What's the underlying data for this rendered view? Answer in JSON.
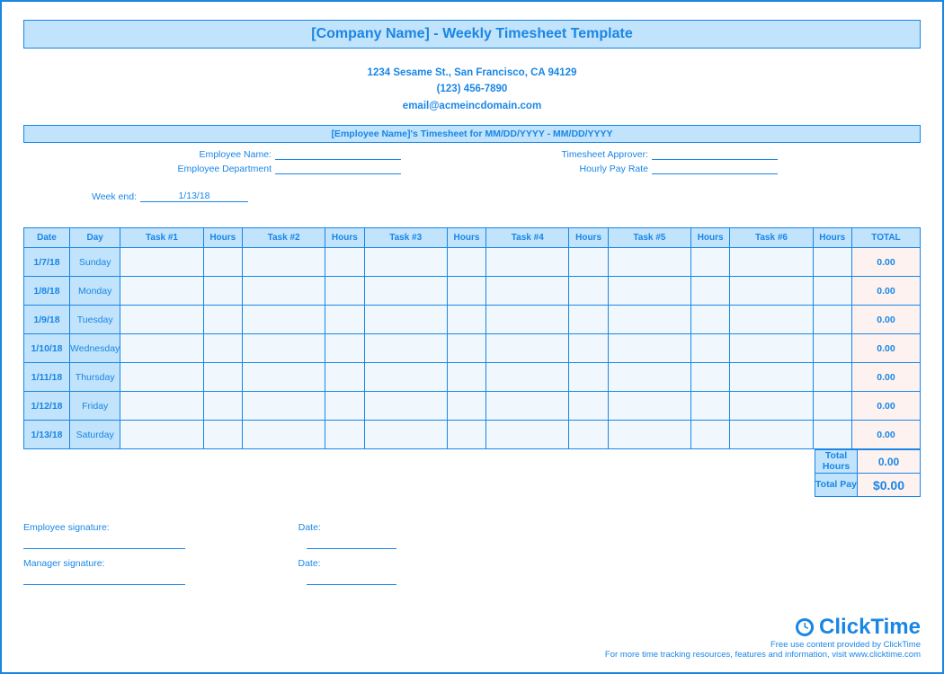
{
  "title": "[Company Name] - Weekly Timesheet Template",
  "company": {
    "address": "1234 Sesame St.,  San Francisco, CA 94129",
    "phone": "(123) 456-7890",
    "email": "email@acmeincdomain.com"
  },
  "timesheet_for": "[Employee Name]'s Timesheet for MM/DD/YYYY - MM/DD/YYYY",
  "fields": {
    "employee_name_label": "Employee Name:",
    "employee_name_value": "",
    "employee_dept_label": "Employee Department",
    "employee_dept_value": "",
    "approver_label": "Timesheet Approver:",
    "approver_value": "",
    "rate_label": "Hourly Pay Rate",
    "rate_value": "",
    "weekend_label": "Week end:",
    "weekend_value": "1/13/18"
  },
  "headers": {
    "date": "Date",
    "day": "Day",
    "task1": "Task #1",
    "task2": "Task #2",
    "task3": "Task #3",
    "task4": "Task #4",
    "task5": "Task #5",
    "task6": "Task #6",
    "hours": "Hours",
    "total": "TOTAL"
  },
  "rows": [
    {
      "date": "1/7/18",
      "day": "Sunday",
      "total": "0.00"
    },
    {
      "date": "1/8/18",
      "day": "Monday",
      "total": "0.00"
    },
    {
      "date": "1/9/18",
      "day": "Tuesday",
      "total": "0.00"
    },
    {
      "date": "1/10/18",
      "day": "Wednesday",
      "total": "0.00"
    },
    {
      "date": "1/11/18",
      "day": "Thursday",
      "total": "0.00"
    },
    {
      "date": "1/12/18",
      "day": "Friday",
      "total": "0.00"
    },
    {
      "date": "1/13/18",
      "day": "Saturday",
      "total": "0.00"
    }
  ],
  "summary": {
    "total_hours_label": "Total Hours",
    "total_hours_value": "0.00",
    "total_pay_label": "Total Pay",
    "total_pay_value": "$0.00"
  },
  "signatures": {
    "emp_sig": "Employee signature:",
    "mgr_sig": "Manager signature:",
    "date": "Date:"
  },
  "footer": {
    "brand": "ClickTime",
    "line1": "Free use content provided by ClickTime",
    "line2": "For more time tracking resources, features and information, visit www.clicktime.com"
  }
}
